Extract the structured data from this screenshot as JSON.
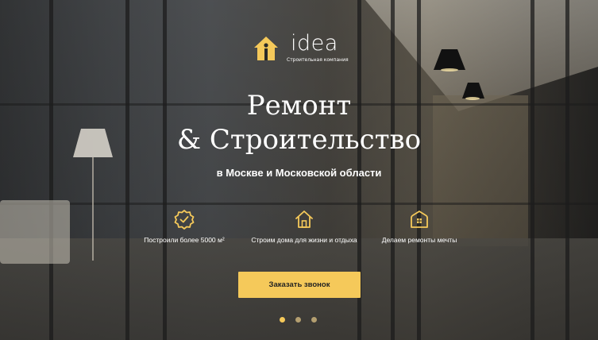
{
  "logo": {
    "wordmark": "idea",
    "tagline": "Строительная компания",
    "icon": "house-i-logo-icon"
  },
  "hero": {
    "title_line1": "Ремонт",
    "title_line2": "& Строительство",
    "subtitle": "в Москве и Московской области"
  },
  "features": [
    {
      "icon": "badge-check-icon",
      "label": "Построили более 5000 м²"
    },
    {
      "icon": "house-icon",
      "label": "Строим дома для жизни и отдыха"
    },
    {
      "icon": "house-grid-icon",
      "label": "Делаем ремонты мечты"
    }
  ],
  "cta": {
    "label": "Заказать звонок"
  },
  "slider": {
    "total": 3,
    "active": 1
  },
  "colors": {
    "accent": "#f5c95a",
    "text": "#ffffff"
  }
}
